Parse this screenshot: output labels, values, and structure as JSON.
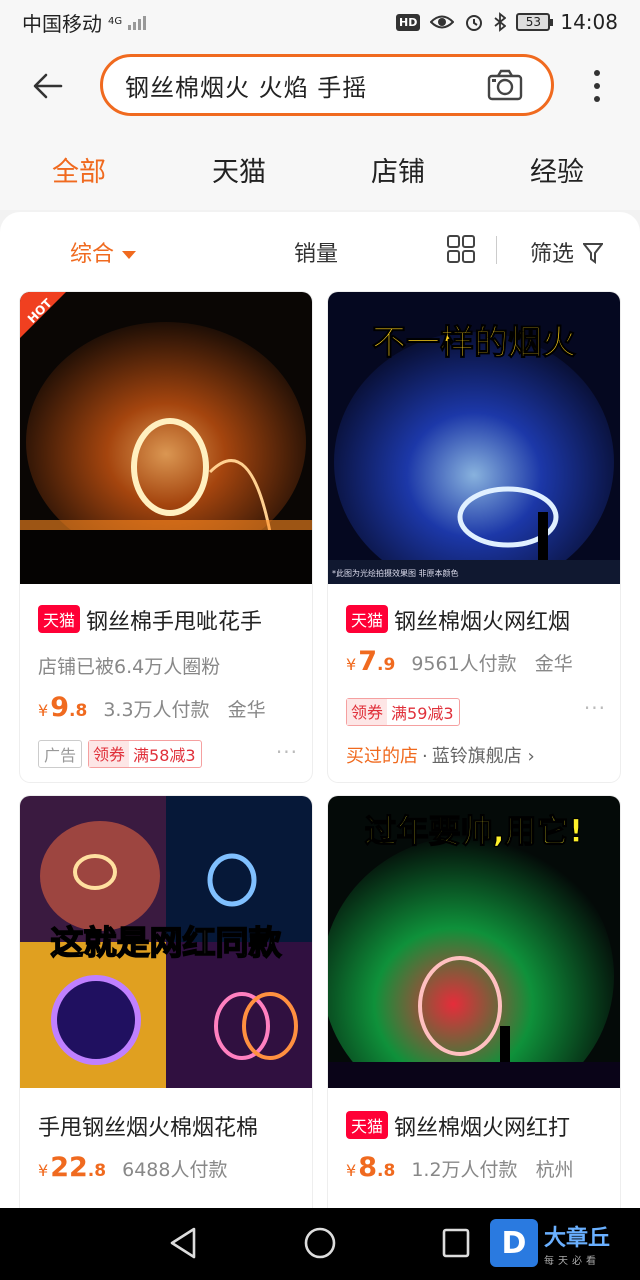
{
  "status": {
    "carrier": "中国移动",
    "network": "4G",
    "battery": "53",
    "time": "14:08",
    "hd": "HD"
  },
  "search": {
    "query": "钢丝棉烟火 火焰 手摇"
  },
  "tabs": [
    "全部",
    "天猫",
    "店铺",
    "经验"
  ],
  "filters": {
    "comprehensive": "综合",
    "sales": "销量",
    "screen": "筛选"
  },
  "products": [
    {
      "tmall": "天猫",
      "title": "钢丝棉手甩呲花手",
      "subline": "店铺已被6.4万人圈粉",
      "price_int": "9",
      "price_dec": ".8",
      "payers": "3.3万人付款",
      "location": "金华",
      "tag_ad": "广告",
      "coupon_a": "领券",
      "coupon_b": "满58减3",
      "hot": "HOT",
      "image_label": ""
    },
    {
      "tmall": "天猫",
      "title": "钢丝棉烟火网红烟",
      "price_int": "7",
      "price_dec": ".9",
      "payers": "9561人付款",
      "location": "金华",
      "coupon_a": "领券",
      "coupon_b": "满59减3",
      "bought": "买过的店",
      "shop": "蓝铃旗舰店",
      "image_label": "不一样的烟火",
      "image_note": "*此图为光绘拍摄效果图 非原本颜色"
    },
    {
      "title": "手甩钢丝烟火棉烟花棉",
      "price_int": "22",
      "price_dec": ".8",
      "payers": "6488人付款",
      "image_label": "这就是网红同款"
    },
    {
      "tmall": "天猫",
      "title": "钢丝棉烟火网红打",
      "price_int": "8",
      "price_dec": ".8",
      "payers": "1.2万人付款",
      "location": "杭州",
      "image_label": "过年要帅,用它!"
    }
  ],
  "currency": "¥",
  "more_dots": "···",
  "watermark": {
    "name": "大章丘",
    "slogan": "每天必看",
    "letter": "D"
  },
  "colors": {
    "accent": "#f06a1f",
    "tmall": "#ff0036"
  }
}
